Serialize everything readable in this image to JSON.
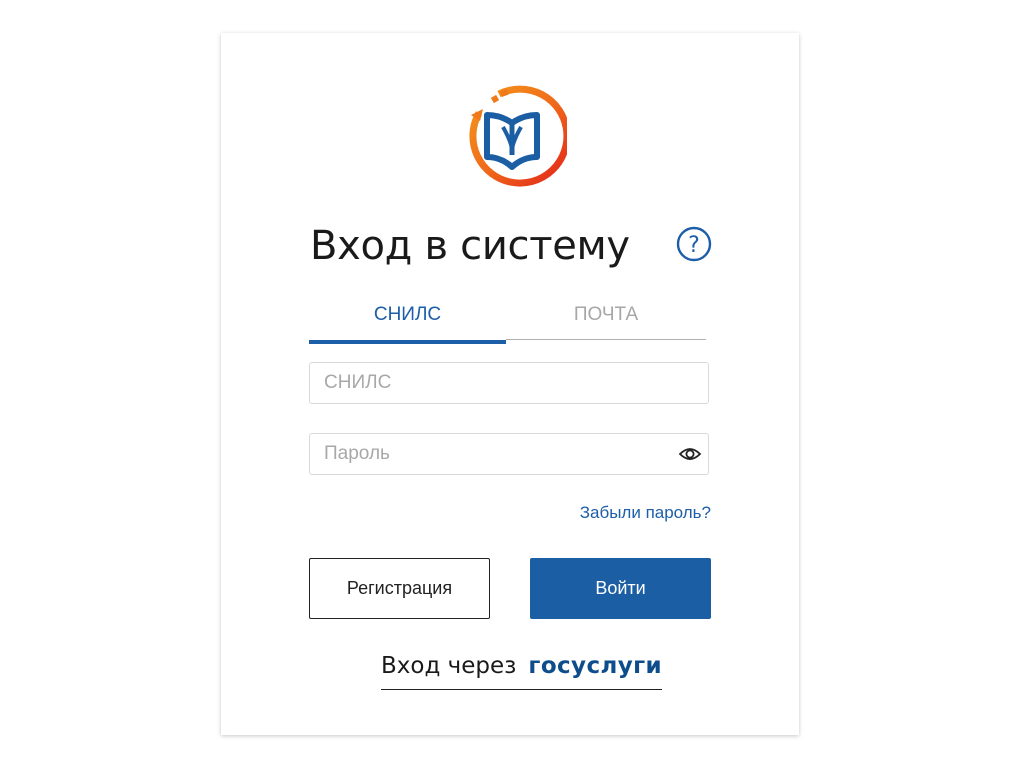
{
  "header": {
    "title": "Вход в систему",
    "logo_icon": "book-circle-logo",
    "help_icon": "question-circle-icon"
  },
  "tabs": [
    {
      "label": "СНИЛС",
      "active": true
    },
    {
      "label": "ПОЧТА",
      "active": false
    }
  ],
  "form": {
    "snils": {
      "placeholder": "СНИЛС",
      "value": ""
    },
    "password": {
      "placeholder": "Пароль",
      "value": ""
    },
    "show_password_icon": "eye-icon",
    "forgot_link": "Забыли пароль?"
  },
  "buttons": {
    "register_label": "Регистрация",
    "login_label": "Войти"
  },
  "gosuslugi": {
    "text": "Вход через",
    "brand": "госуслуги"
  },
  "colors": {
    "accent": "#1d5ea8",
    "logo_orange": "#f07a1a",
    "logo_red": "#e2231a",
    "logo_blue": "#1b5ea3"
  }
}
